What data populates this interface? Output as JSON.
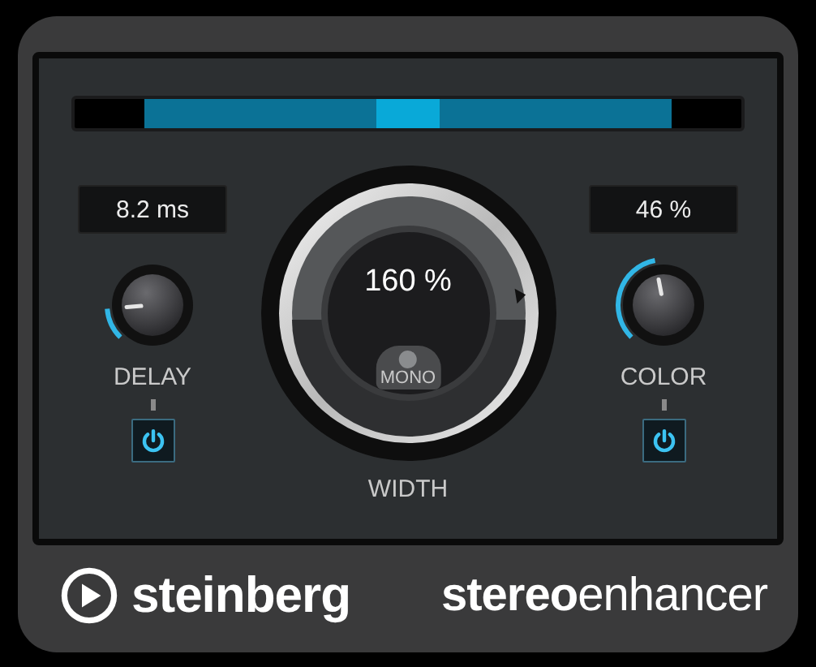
{
  "delay": {
    "value": "8.2 ms",
    "label": "DELAY",
    "power": {
      "on": true
    }
  },
  "width": {
    "value": "160 %",
    "label": "WIDTH",
    "mono": {
      "label": "MONO",
      "on": false
    }
  },
  "color": {
    "value": "46 %",
    "label": "COLOR",
    "power": {
      "on": true
    }
  },
  "footer": {
    "brand": "steinberg",
    "product": "**stereo**enhancer"
  }
}
